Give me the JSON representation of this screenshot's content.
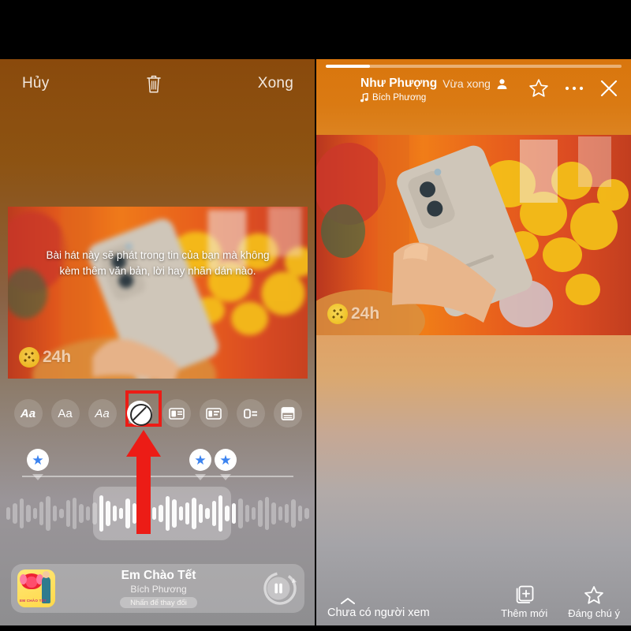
{
  "left_panel": {
    "header": {
      "cancel_label": "Hủy",
      "delete_icon": "trash-icon",
      "done_label": "Xong"
    },
    "photo": {
      "overlay_text": "Bài hát này sẽ phát trong tin của bạn mà không kèm thêm văn bản, lời hay nhãn dán nào.",
      "watermark_text": "24h"
    },
    "style_toolbar": {
      "items": [
        {
          "label": "Aa",
          "name": "text-style-bold",
          "selected": false
        },
        {
          "label": "Aa",
          "name": "text-style-regular",
          "selected": false
        },
        {
          "label": "Aa",
          "name": "text-style-italic",
          "selected": false
        },
        {
          "label": "",
          "name": "no-lyrics-option",
          "selected": true
        },
        {
          "label": "",
          "name": "layout-split-card",
          "selected": false
        },
        {
          "label": "",
          "name": "layout-wide-card",
          "selected": false
        },
        {
          "label": "",
          "name": "layout-compact-card",
          "selected": false
        },
        {
          "label": "",
          "name": "layout-stacked-card",
          "selected": false
        }
      ],
      "highlight_color": "#ec1c16"
    },
    "timeline": {
      "markers": [
        {
          "position_pct": 12
        },
        {
          "position_pct": 64
        },
        {
          "position_pct": 71
        }
      ],
      "marker_icon": "star-marker",
      "selection_start_pct": 30,
      "selection_width_pct": 44
    },
    "music_card": {
      "title": "Em Chào Tết",
      "artist": "Bích Phương",
      "hint_label": "Nhấn để thay đổi",
      "album_caption": "EM CHÀO TẾT",
      "player_state": "pause"
    },
    "annotation": {
      "arrow_color": "#ec1c16",
      "arrow_direction": "up"
    }
  },
  "right_panel": {
    "progress_pct": 15,
    "header": {
      "author_name": "Như Phượng",
      "timestamp": "Vừa xong",
      "audience_icon": "person-icon",
      "song_label": "Bích Phương",
      "music_note_icon": "music-note-icon",
      "star_icon": "star-outline-icon",
      "more_icon": "ellipsis-icon",
      "close_icon": "close-icon"
    },
    "photo": {
      "watermark_text": "24h"
    },
    "bottom_bar": {
      "viewers_label": "Chưa có người xem",
      "chevron_icon": "chevron-up-icon",
      "add_label": "Thêm mới",
      "add_icon": "add-card-icon",
      "highlight_label": "Đáng chú ý",
      "highlight_icon": "star-outline-icon"
    }
  },
  "colors": {
    "accent_orange": "#d9760d",
    "highlight_red": "#ec1c16",
    "marker_blue": "#3b83f0"
  }
}
